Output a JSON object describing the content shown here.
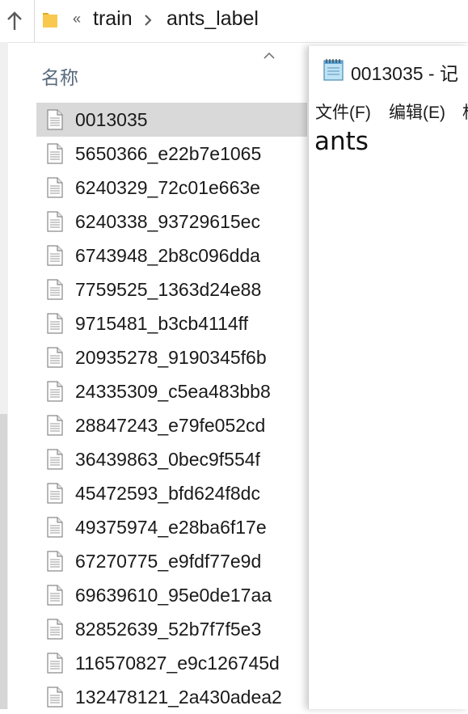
{
  "explorer": {
    "breadcrumb": {
      "overflow": "«",
      "items": [
        "train",
        "ants_label"
      ]
    },
    "column_header": "名称",
    "files": [
      "0013035",
      "5650366_e22b7e1065",
      "6240329_72c01e663e",
      "6240338_93729615ec",
      "6743948_2b8c096dda",
      "7759525_1363d24e88",
      "9715481_b3cb4114ff",
      "20935278_9190345f6b",
      "24335309_c5ea483bb8",
      "28847243_e79fe052cd",
      "36439863_0bec9f554f",
      "45472593_bfd624f8dc",
      "49375974_e28ba6f17e",
      "67270775_e9fdf77e9d",
      "69639610_95e0de17aa",
      "82852639_52b7f7f5e3",
      "116570827_e9c126745d",
      "132478121_2a430adea2"
    ],
    "selected_file": "0013035"
  },
  "notepad": {
    "title": "0013035 - 记",
    "menu": [
      "文件(F)",
      "编辑(E)",
      "格"
    ],
    "content": "ants"
  },
  "colors": {
    "selection": "#d9d9d9",
    "folder": "#f8c94c",
    "header_text": "#5a6b7e"
  }
}
